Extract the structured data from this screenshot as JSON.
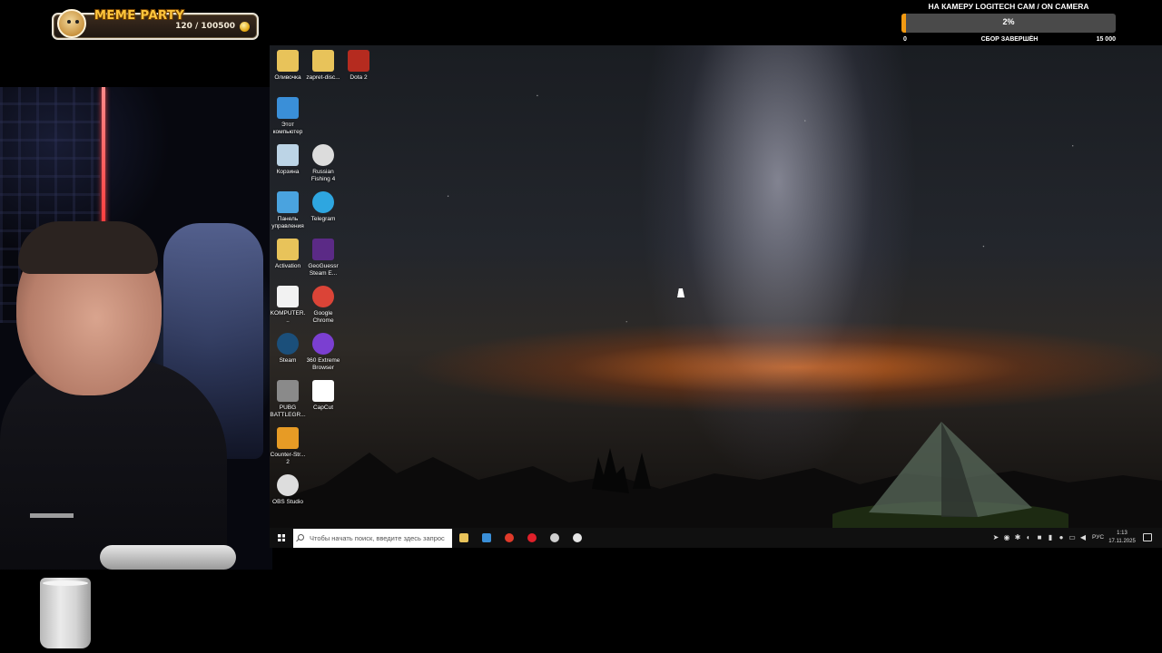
{
  "overlay": {
    "meme_party": {
      "title": "MEME PARTY",
      "count": "120 / 100500"
    },
    "camera_goal": {
      "title": "НА КАМЕРУ LOGITECH CAM / ON CAMERA",
      "percent_label": "2%",
      "progress": 0.02,
      "min_label": "0",
      "status_label": "СБОР ЗАВЕРШЁН",
      "max_label": "15 000",
      "fill_color": "#f29a12"
    }
  },
  "desktop": {
    "icons": [
      {
        "label": "Оливочка",
        "icon": "folder-icon",
        "color": "#e8c35a"
      },
      {
        "label": "zapret-disc...",
        "icon": "folder-icon",
        "color": "#e8c35a"
      },
      {
        "label": "Dota 2",
        "icon": "dota-icon",
        "color": "#b52b1f"
      },
      {
        "label": "Этот компьютер",
        "icon": "computer-icon",
        "color": "#3a8fd8"
      },
      {
        "label": "Корзина",
        "icon": "recycle-bin-icon",
        "color": "#bcd4e6"
      },
      {
        "label": "Russian Fishing 4",
        "icon": "fishing-icon",
        "color": "#dcdcdc"
      },
      {
        "label": "Панель управления",
        "icon": "control-panel-icon",
        "color": "#4aa3df"
      },
      {
        "label": "Telegram",
        "icon": "telegram-icon",
        "color": "#2ea6e0"
      },
      {
        "label": "Activation",
        "icon": "folder-icon",
        "color": "#e8c35a"
      },
      {
        "label": "GeoGuessr Steam E...",
        "icon": "geoguessr-icon",
        "color": "#5b2a86"
      },
      {
        "label": "KOMPUTER...",
        "icon": "file-icon",
        "color": "#f2f2f2"
      },
      {
        "label": "Google Chrome",
        "icon": "chrome-icon",
        "color": "#db4437"
      },
      {
        "label": "Steam",
        "icon": "steam-icon",
        "color": "#1b4f7a"
      },
      {
        "label": "360 Extreme Browser",
        "icon": "browser-360-icon",
        "color": "#7b3fd1"
      },
      {
        "label": "PUBG BATTLEGR...",
        "icon": "pubg-icon",
        "color": "#8a8a8a"
      },
      {
        "label": "CapCut",
        "icon": "capcut-icon",
        "color": "#ffffff"
      },
      {
        "label": "Counter-Str... 2",
        "icon": "cs2-icon",
        "color": "#e79b25"
      },
      {
        "label": "OBS Studio",
        "icon": "obs-icon",
        "color": "#dddddd"
      }
    ]
  },
  "taskbar": {
    "search_placeholder": "Чтобы начать поиск, введите здесь запрос",
    "pinned": [
      {
        "icon": "file-explorer-icon",
        "color": "#e8c35a"
      },
      {
        "icon": "store-icon",
        "color": "#3a8fd8"
      },
      {
        "icon": "yandex-icon",
        "color": "#e03a2a"
      },
      {
        "icon": "opera-icon",
        "color": "#e0202a"
      },
      {
        "icon": "obs-icon",
        "color": "#cfcfcf"
      },
      {
        "icon": "settings-icon",
        "color": "#e6e6e6"
      }
    ],
    "language": "РУС",
    "time": "1:13",
    "date": "17.11.2025"
  }
}
